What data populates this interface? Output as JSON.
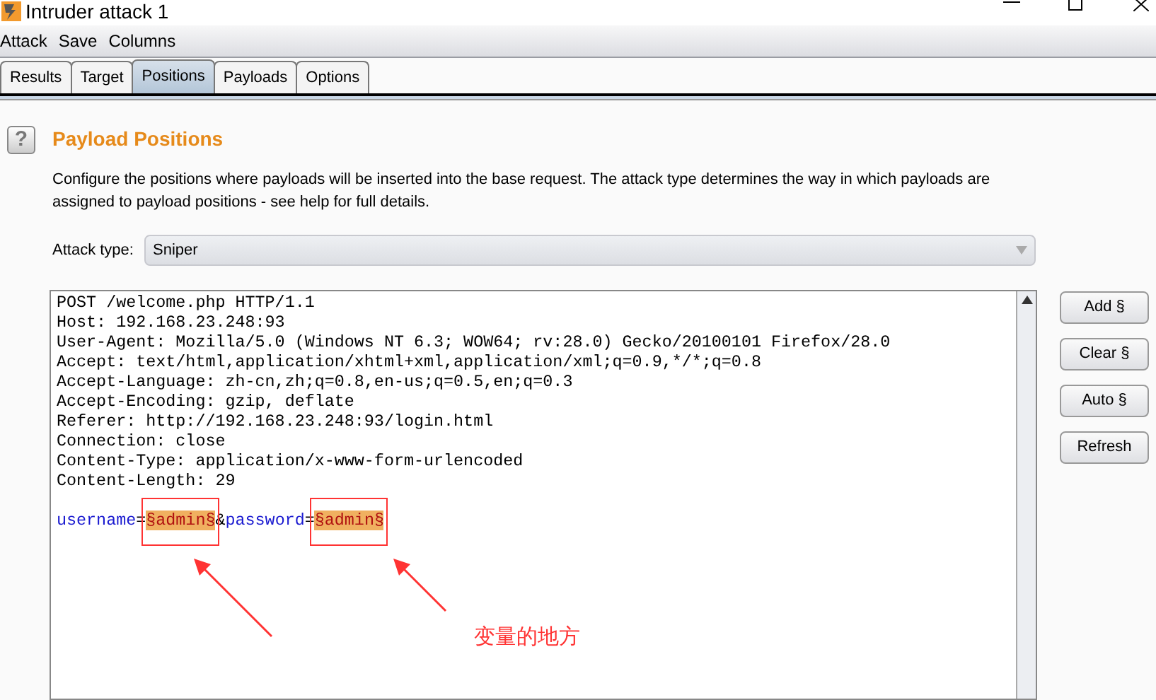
{
  "window": {
    "title": "Intruder attack 1"
  },
  "menu": [
    "Attack",
    "Save",
    "Columns"
  ],
  "tabs": [
    {
      "label": "Results",
      "selected": false
    },
    {
      "label": "Target",
      "selected": false
    },
    {
      "label": "Positions",
      "selected": true
    },
    {
      "label": "Payloads",
      "selected": false
    },
    {
      "label": "Options",
      "selected": false
    }
  ],
  "help_button": "?",
  "section": {
    "title": "Payload Positions",
    "description": "Configure the positions where payloads will be inserted into the base request. The attack type determines the way in which payloads are assigned to payload positions - see help for full details."
  },
  "attack_type": {
    "label": "Attack type:",
    "value": "Sniper"
  },
  "request_lines": [
    "POST /welcome.php HTTP/1.1",
    "Host: 192.168.23.248:93",
    "User-Agent: Mozilla/5.0 (Windows NT 6.3; WOW64; rv:28.0) Gecko/20100101 Firefox/28.0",
    "Accept: text/html,application/xhtml+xml,application/xml;q=0.9,*/*;q=0.8",
    "Accept-Language: zh-cn,zh;q=0.8,en-us;q=0.5,en;q=0.3",
    "Accept-Encoding: gzip, deflate",
    "Referer: http://192.168.23.248:93/login.html",
    "Connection: close",
    "Content-Type: application/x-www-form-urlencoded",
    "Content-Length: 29"
  ],
  "request_body": [
    {
      "kind": "name",
      "text": "username"
    },
    {
      "kind": "plain",
      "text": "="
    },
    {
      "kind": "payload",
      "text": "§admin§",
      "marked": true
    },
    {
      "kind": "plain",
      "text": "&"
    },
    {
      "kind": "name",
      "text": "password"
    },
    {
      "kind": "plain",
      "text": "="
    },
    {
      "kind": "payload",
      "text": "§admin§",
      "marked": true
    }
  ],
  "buttons": [
    "Add §",
    "Clear §",
    "Auto §",
    "Refresh"
  ],
  "annotation": {
    "label": "变量的地方"
  }
}
